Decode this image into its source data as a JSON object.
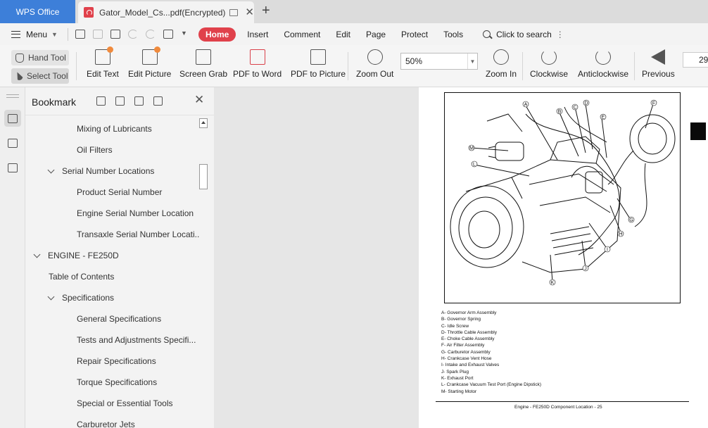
{
  "app": {
    "name": "WPS Office"
  },
  "tab": {
    "title": "Gator_Model_Cs...pdf(Encrypted)"
  },
  "menu": {
    "label": "Menu",
    "tabs": [
      "Home",
      "Insert",
      "Comment",
      "Edit",
      "Page",
      "Protect",
      "Tools"
    ],
    "active_tab": "Home",
    "search_label": "Click to search"
  },
  "toolbar": {
    "hand_tool": "Hand Tool",
    "select_tool": "Select Tool",
    "buttons": [
      "Edit Text",
      "Edit Picture",
      "Screen Grab",
      "PDF to Word",
      "PDF to Picture",
      "Zoom Out",
      "Zoom In",
      "Clockwise",
      "Anticlockwise",
      "Previous"
    ],
    "zoom_value": "50%",
    "page_number": "29"
  },
  "bookmark": {
    "title": "Bookmark",
    "items": [
      {
        "label": "Mixing of Lubricants",
        "level": 3,
        "expandable": false
      },
      {
        "label": "Oil Filters",
        "level": 3,
        "expandable": false
      },
      {
        "label": "Serial Number Locations",
        "level": 2,
        "expandable": true
      },
      {
        "label": "Product Serial Number",
        "level": 3,
        "expandable": false
      },
      {
        "label": "Engine Serial Number Location",
        "level": 3,
        "expandable": false
      },
      {
        "label": "Transaxle Serial Number Locati..",
        "level": 3,
        "expandable": false
      },
      {
        "label": "ENGINE - FE250D",
        "level": 1,
        "expandable": true
      },
      {
        "label": "Table of Contents",
        "level": 2,
        "expandable": false
      },
      {
        "label": "Specifications",
        "level": 2,
        "expandable": true
      },
      {
        "label": "General Specifications",
        "level": 3,
        "expandable": false
      },
      {
        "label": "Tests and Adjustments Specifi...",
        "level": 3,
        "expandable": false
      },
      {
        "label": "Repair Specifications",
        "level": 3,
        "expandable": false
      },
      {
        "label": "Torque Specifications",
        "level": 3,
        "expandable": false
      },
      {
        "label": "Special or Essential Tools",
        "level": 3,
        "expandable": false
      },
      {
        "label": "Carburetor Jets",
        "level": 3,
        "expandable": false
      }
    ]
  },
  "document": {
    "callouts": [
      "A",
      "B",
      "C",
      "D",
      "E",
      "F",
      "G",
      "H",
      "I",
      "J",
      "K",
      "L",
      "M"
    ],
    "legend": [
      "A- Governor Arm Assembly",
      "B- Governor Spring",
      "C- Idle Screw",
      "D- Throttle Cable Assembly",
      "E- Choke Cable Assembly",
      "F- Air Filter Assembly",
      "G- Carburetor Assembly",
      "H- Crankcase Vent Hose",
      "I- Intake and Exhaust Valves",
      "J- Spark Plug",
      "K- Exhaust Port",
      "L- Crankcase Vacuum Test Port (Engine Dipstick)",
      "M- Starting Motor"
    ],
    "footer": "Engine - FE250D   Component Location  - 25"
  },
  "colors": {
    "accent": "#e0414b",
    "app_tab": "#3d7fd9"
  }
}
